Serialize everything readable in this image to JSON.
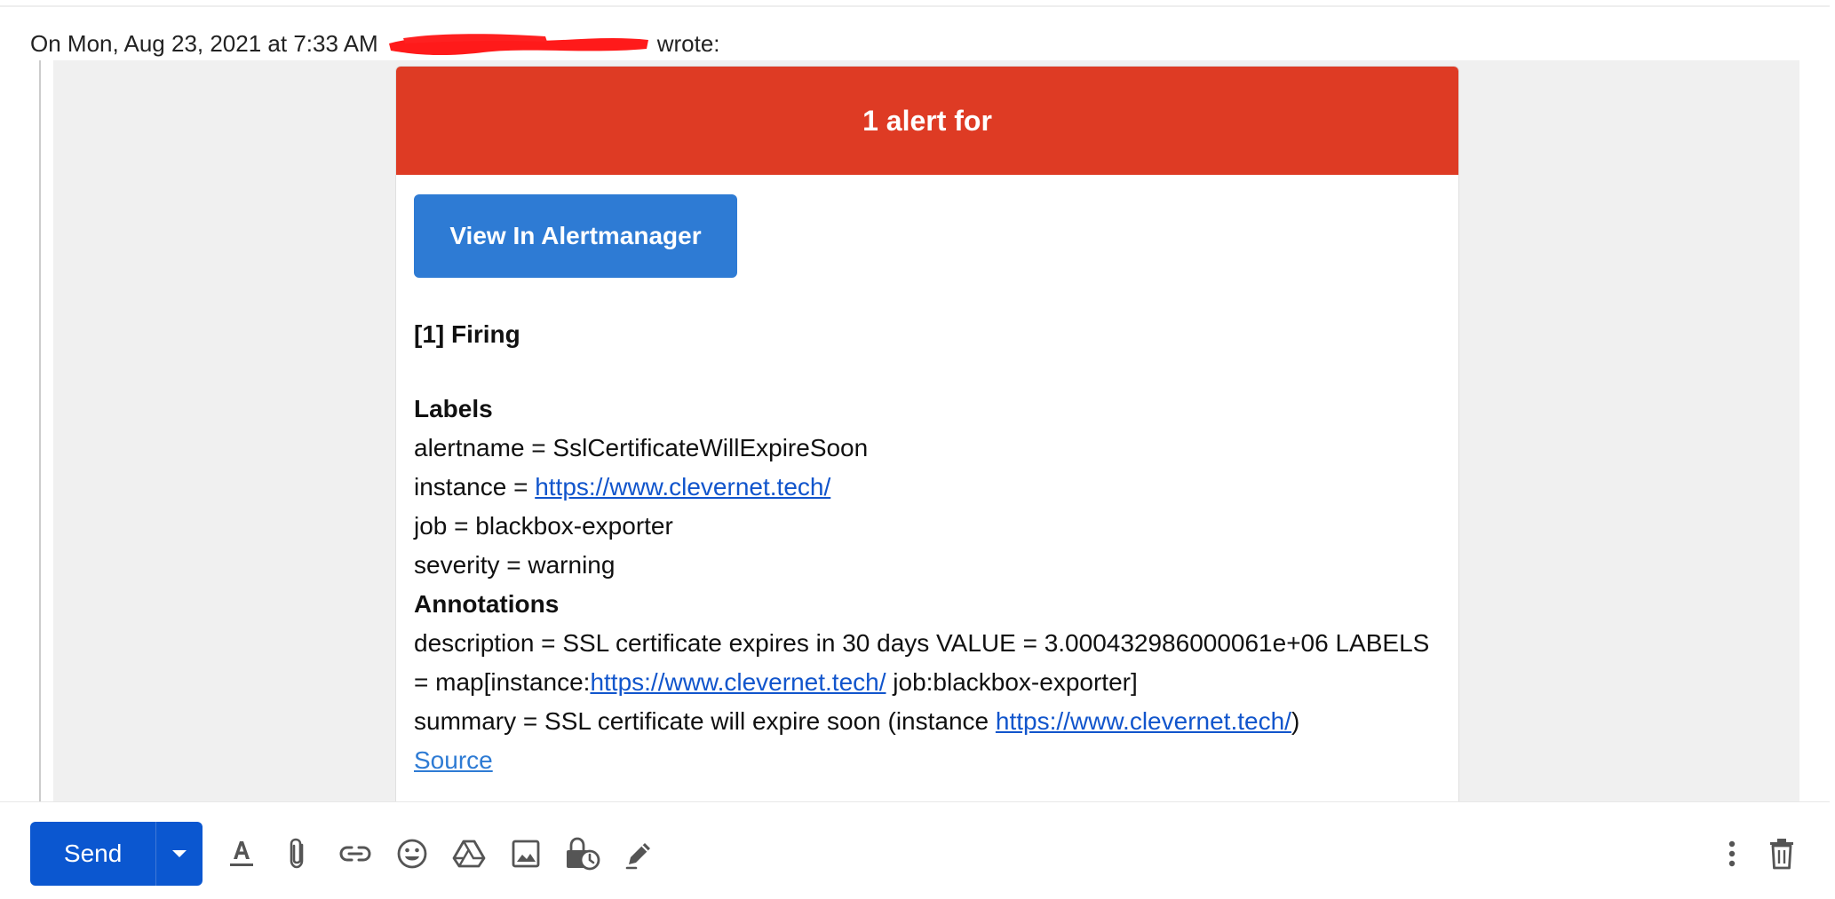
{
  "quote": {
    "header_prefix": "On Mon, Aug 23, 2021 at 7:33 AM",
    "header_suffix": "wrote:"
  },
  "alert_email": {
    "header_title": "1 alert for",
    "view_button_label": "View In Alertmanager",
    "firing_heading": "[1] Firing",
    "labels_heading": "Labels",
    "labels": {
      "alertname": "alertname = SslCertificateWillExpireSoon",
      "instance_prefix": "instance = ",
      "instance_link": "https://www.clevernet.tech/",
      "job": "job = blackbox-exporter",
      "severity": "severity = warning"
    },
    "annotations_heading": "Annotations",
    "annotations": {
      "description_line1": "description = SSL certificate expires in 30 days VALUE = 3.000432986000061e+06 LABELS",
      "description_line2_prefix": "= map[instance:",
      "description_link": "https://www.clevernet.tech/",
      "description_line2_suffix": " job:blackbox-exporter]",
      "summary_prefix": "summary = SSL certificate will expire soon (instance ",
      "summary_link": "https://www.clevernet.tech/",
      "summary_suffix": ")"
    },
    "source_link": "Source"
  },
  "compose_toolbar": {
    "send_label": "Send",
    "icons": [
      "text-format-icon",
      "attach-icon",
      "link-icon",
      "emoji-icon",
      "drive-icon",
      "image-icon",
      "confidential-lock-icon",
      "signature-pen-icon",
      "more-options-icon",
      "delete-icon"
    ]
  },
  "colors": {
    "alert_header": "#de3b24",
    "view_button": "#2e7bd4",
    "send_button": "#0b57d0",
    "link": "#1155cc"
  }
}
